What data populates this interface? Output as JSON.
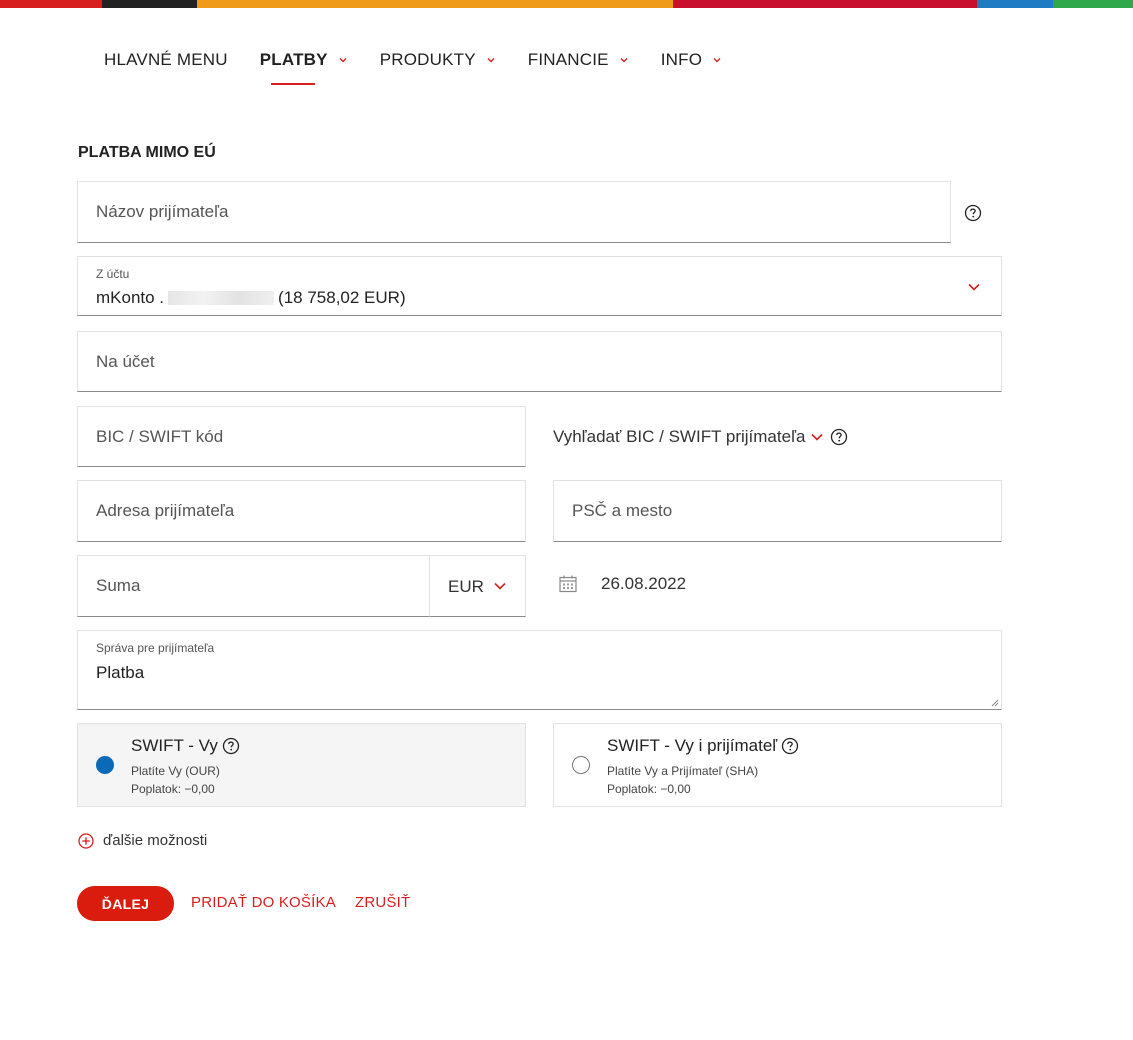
{
  "topbar_colors": [
    "#d71f1f",
    "#222222",
    "#f09a1a",
    "#c8102e",
    "#1e7bc4",
    "#2ea84a"
  ],
  "nav": {
    "items": [
      {
        "label": "HLAVNÉ MENU"
      },
      {
        "label": "PLATBY"
      },
      {
        "label": "PRODUKTY"
      },
      {
        "label": "FINANCIE"
      },
      {
        "label": "INFO"
      }
    ],
    "active": "PLATBY"
  },
  "page": {
    "title": "PLATBA MIMO EÚ"
  },
  "form": {
    "recipient_name": {
      "placeholder": "Názov prijímateľa"
    },
    "from_account": {
      "label": "Z účtu",
      "account_name": "mKonto .",
      "balance": "(18 758,02 EUR)"
    },
    "to_account": {
      "placeholder": "Na účet"
    },
    "bic": {
      "placeholder": "BIC / SWIFT kód"
    },
    "bic_search": {
      "label": "Vyhľadať BIC / SWIFT prijímateľa"
    },
    "address": {
      "placeholder": "Adresa prijímateľa"
    },
    "postal_city": {
      "placeholder": "PSČ a mesto"
    },
    "amount": {
      "placeholder": "Suma",
      "currency": "EUR"
    },
    "date": {
      "value": "26.08.2022"
    },
    "message": {
      "label": "Správa pre prijímateľa",
      "value": "Platba"
    }
  },
  "fee_options": [
    {
      "title": "SWIFT - Vy",
      "line1": "Platíte Vy (OUR)",
      "line2": "Poplatok: −0,00",
      "selected": true
    },
    {
      "title": "SWIFT - Vy i prijímateľ",
      "line1": "Platíte Vy a Prijímateľ (SHA)",
      "line2": "Poplatok: −0,00",
      "selected": false
    }
  ],
  "more_options": {
    "label": "ďalšie možnosti"
  },
  "actions": {
    "next": "ĎALEJ",
    "add_to_cart": "PRIDAŤ DO KOŠÍKA",
    "cancel": "ZRUŠIŤ"
  },
  "colors": {
    "accent": "#d71f1f",
    "button": "#d91c0d",
    "radio_selected": "#0a6ab8"
  }
}
